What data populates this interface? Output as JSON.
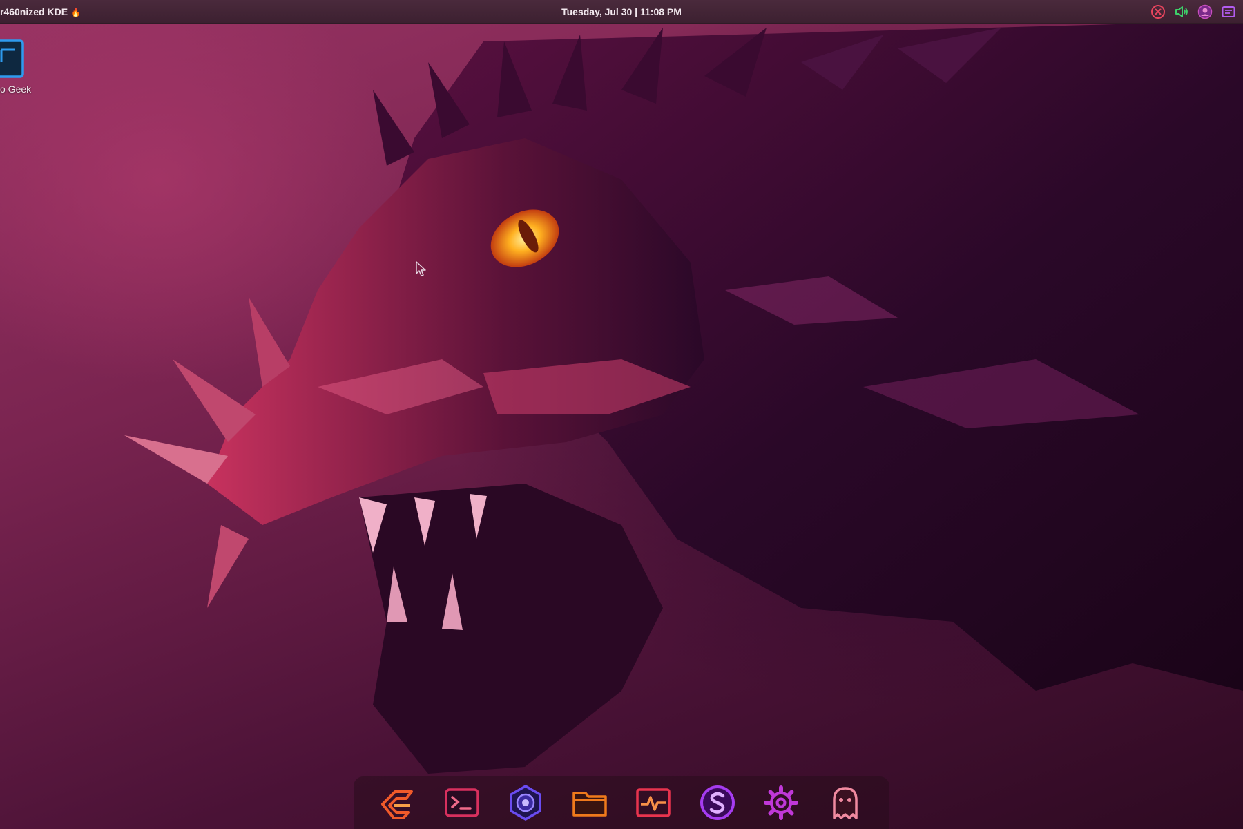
{
  "panel": {
    "title": "r460nized KDE",
    "flame_glyph": "🔥",
    "datetime": "Tuesday, Jul 30 | 11:08 PM",
    "tray": [
      {
        "icon": "close-circle-icon",
        "color": "#e8455e"
      },
      {
        "icon": "volume-icon",
        "color": "#3ecf6a"
      },
      {
        "icon": "user-avatar-icon",
        "color": "#c94fbf"
      },
      {
        "icon": "window-list-icon",
        "color": "#b25cf0"
      }
    ]
  },
  "desktop": {
    "icons": [
      {
        "label": "o Geek",
        "icon": "folder-frame-icon",
        "color": "#2e9bef"
      }
    ]
  },
  "dock": {
    "items": [
      {
        "name": "app-launcher",
        "icon": "launcher-logo-icon",
        "color": "#f05a2a"
      },
      {
        "name": "terminal",
        "icon": "terminal-icon",
        "color": "#d8305e"
      },
      {
        "name": "browser",
        "icon": "hexagon-globe-icon",
        "color": "#6a4cf0"
      },
      {
        "name": "file-manager",
        "icon": "folder-icon",
        "color": "#f07a1c"
      },
      {
        "name": "system-monitor",
        "icon": "pulse-icon",
        "color": "#e8344e"
      },
      {
        "name": "store",
        "icon": "s-circle-icon",
        "color": "#a63cf0"
      },
      {
        "name": "settings",
        "icon": "gear-icon",
        "color": "#c038d8"
      },
      {
        "name": "ghost-app",
        "icon": "ghost-icon",
        "color": "#f08aa0"
      }
    ]
  }
}
